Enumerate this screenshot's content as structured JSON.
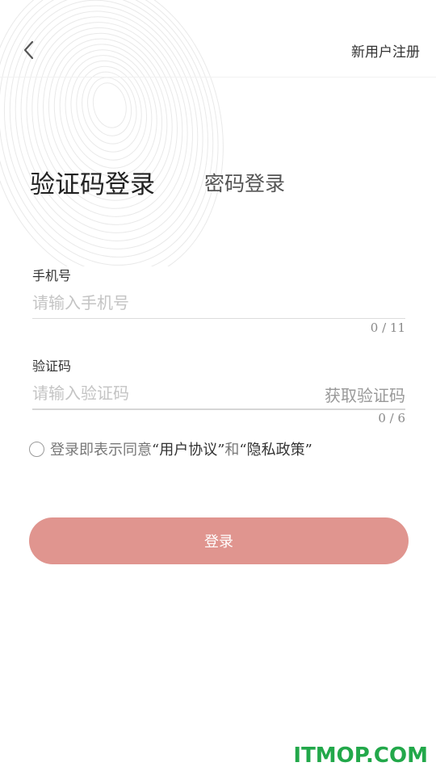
{
  "header": {
    "back_icon": "chevron-left-icon",
    "register_label": "新用户注册"
  },
  "tabs": {
    "active_label": "验证码登录",
    "inactive_label": "密码登录"
  },
  "phone": {
    "label": "手机号",
    "placeholder": "请输入手机号",
    "value": "",
    "counter": "0 / 11"
  },
  "code": {
    "label": "验证码",
    "placeholder": "请输入验证码",
    "value": "",
    "get_code_label": "获取验证码",
    "counter": "0 / 6"
  },
  "agreement": {
    "checked": false,
    "prefix": "登录即表示同意",
    "user_agreement": "“用户协议”",
    "conjunction": "和",
    "privacy_policy": "“隐私政策”"
  },
  "login_button": {
    "label": "登录",
    "color": "#e0958f"
  },
  "watermark": {
    "text": "ITMOP.COM",
    "color": "#22a84a"
  },
  "decoration": {
    "icon": "fingerprint-icon"
  }
}
